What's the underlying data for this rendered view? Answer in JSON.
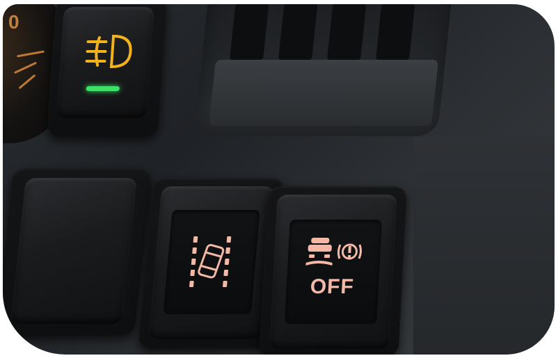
{
  "scene": {
    "description_type": "photo",
    "switches": {
      "fog_light": {
        "icon": "fog-light-icon",
        "indicator_color": "#3fe06a",
        "icon_color": "#f2b21b"
      },
      "blank": {
        "icon": ""
      },
      "lane_assist": {
        "icon": "lane-departure-icon",
        "icon_color": "#f4b9a6"
      },
      "traction_off": {
        "icon": "traction-control-off-icon",
        "label": "OFF",
        "icon_color": "#f4b9a6"
      }
    }
  }
}
